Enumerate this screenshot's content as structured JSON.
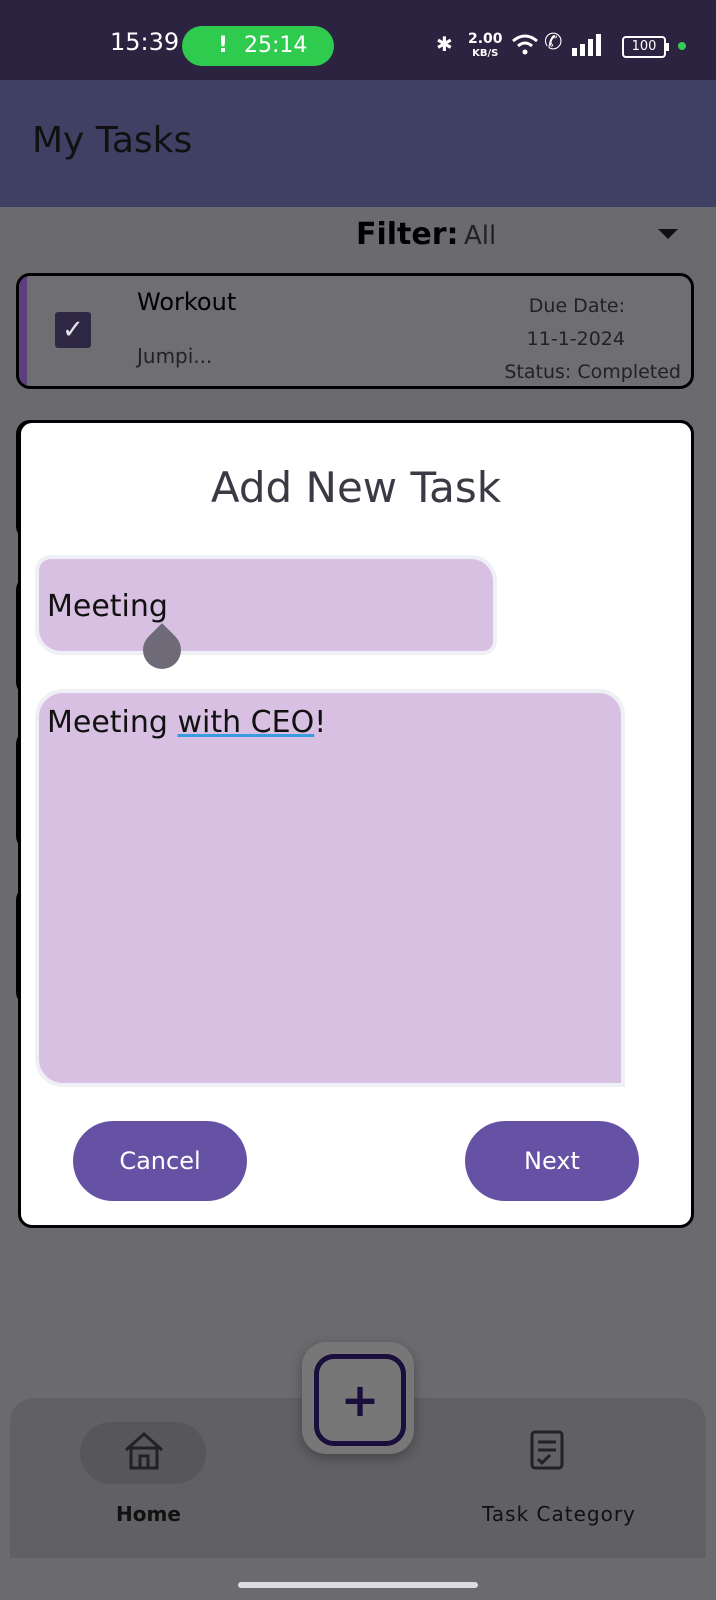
{
  "status_bar": {
    "time": "15:39",
    "call_timer": "25:14",
    "net_speed_value": "2.00",
    "net_speed_unit": "KB/S",
    "battery": "100"
  },
  "app_bar": {
    "title": "My Tasks"
  },
  "filter": {
    "label": "Filter:",
    "value": "All"
  },
  "task_list": [
    {
      "title": "Workout",
      "description": "Jumpi...",
      "due_label": "Due Date:",
      "due_date": "11-1-2024",
      "status": "Status: Completed",
      "completed": true
    }
  ],
  "dialog": {
    "title": "Add New Task",
    "task_title_value": "Meeting",
    "description_value_part1": "Meeting ",
    "description_value_part2": "with CEO",
    "description_value_part3": "!",
    "cancel_label": "Cancel",
    "next_label": "Next"
  },
  "bottom_nav": {
    "items": [
      {
        "label": "Home",
        "icon": "home-icon",
        "active": true
      },
      {
        "label": "Task Category",
        "icon": "task-list-icon",
        "active": false
      }
    ],
    "fab_icon": "plus-icon"
  },
  "colors": {
    "accent": "#6652a5",
    "field_bg": "#d8c0e2",
    "app_bar": "#3f4063",
    "status_bar": "#2b2340"
  }
}
